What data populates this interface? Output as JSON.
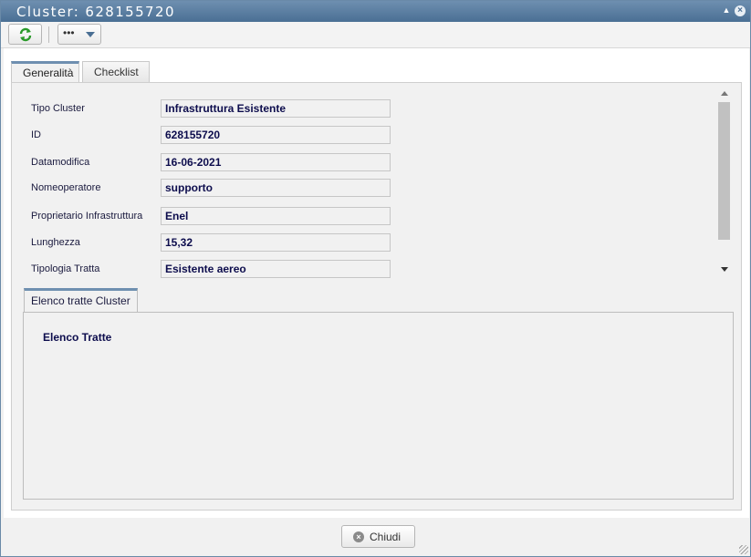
{
  "window": {
    "title": "Cluster: 628155720"
  },
  "toolbar": {
    "more_label": "•••"
  },
  "tabs": [
    {
      "label": "Generalità",
      "active": true
    },
    {
      "label": "Checklist",
      "active": false
    }
  ],
  "form": {
    "rows": [
      {
        "label": "Tipo Cluster",
        "value": "Infrastruttura Esistente"
      },
      {
        "label": "ID",
        "value": "628155720"
      },
      {
        "label": "Datamodifica",
        "value": "16-06-2021"
      },
      {
        "label": "Nomeoperatore",
        "value": "supporto"
      },
      {
        "label": "Proprietario Infrastruttura",
        "value": "Enel"
      },
      {
        "label": "Lunghezza",
        "value": "15,32"
      },
      {
        "label": "Tipologia Tratta",
        "value": "Esistente aereo"
      }
    ]
  },
  "subsection": {
    "tab_label": "Elenco tratte Cluster",
    "heading": "Elenco Tratte"
  },
  "footer": {
    "close_label": "Chiudi"
  },
  "icons": {
    "refresh": "refresh-icon",
    "close_window": "close-icon",
    "minimize": "minimize-icon",
    "close_button": "close-circle-icon"
  },
  "colors": {
    "titlebar": "#5a7fa3",
    "value_text": "#0d0d4d",
    "refresh_icon": "#2a9a2a"
  }
}
